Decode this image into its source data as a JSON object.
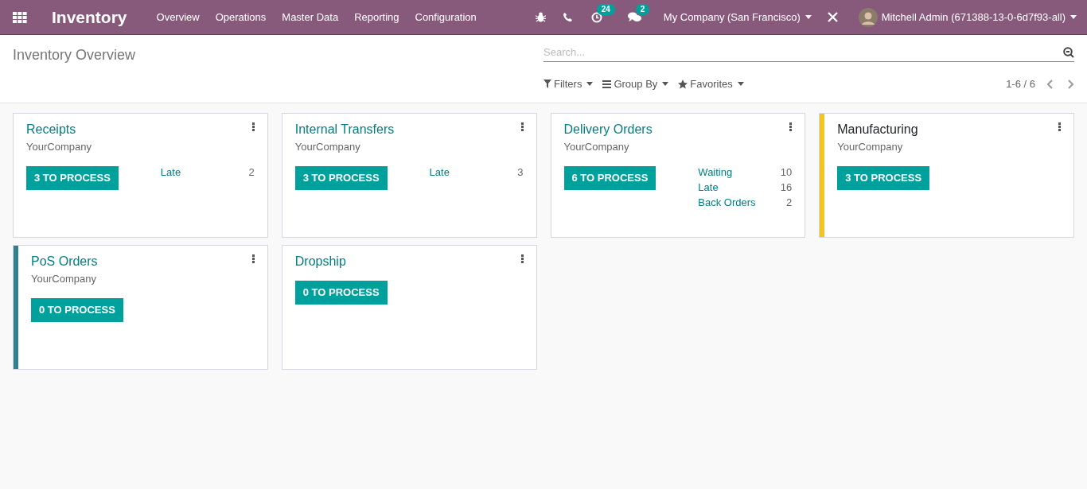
{
  "navbar": {
    "app_title": "Inventory",
    "menu": [
      "Overview",
      "Operations",
      "Master Data",
      "Reporting",
      "Configuration"
    ],
    "activity_count": "24",
    "message_count": "2",
    "company": "My Company (San Francisco)",
    "user": "Mitchell Admin (671388-13-0-6d7f93-all)"
  },
  "control_panel": {
    "breadcrumb": "Inventory Overview",
    "search": {
      "placeholder": "Search..."
    },
    "filters": [
      "Filters",
      "Group By",
      "Favorites"
    ],
    "pager": "1-6 / 6"
  },
  "cards": [
    {
      "title": "Receipts",
      "title_link": true,
      "company": "YourCompany",
      "button": "3 TO PROCESS",
      "stats": [
        {
          "label": "Late",
          "value": "2"
        }
      ]
    },
    {
      "title": "Internal Transfers",
      "title_link": true,
      "company": "YourCompany",
      "button": "3 TO PROCESS",
      "stats": [
        {
          "label": "Late",
          "value": "3"
        }
      ]
    },
    {
      "title": "Delivery Orders",
      "title_link": true,
      "company": "YourCompany",
      "button": "6 TO PROCESS",
      "stats": [
        {
          "label": "Waiting",
          "value": "10"
        },
        {
          "label": "Late",
          "value": "16"
        },
        {
          "label": "Back Orders",
          "value": "2"
        }
      ]
    },
    {
      "title": "Manufacturing",
      "title_link": false,
      "company": "YourCompany",
      "color": "#f4c521",
      "button": "3 TO PROCESS"
    },
    {
      "title": "PoS Orders",
      "title_link": true,
      "company": "YourCompany",
      "color": "#30818e",
      "button": "0 TO PROCESS"
    },
    {
      "title": "Dropship",
      "title_link": true,
      "button": "0 TO PROCESS"
    }
  ]
}
